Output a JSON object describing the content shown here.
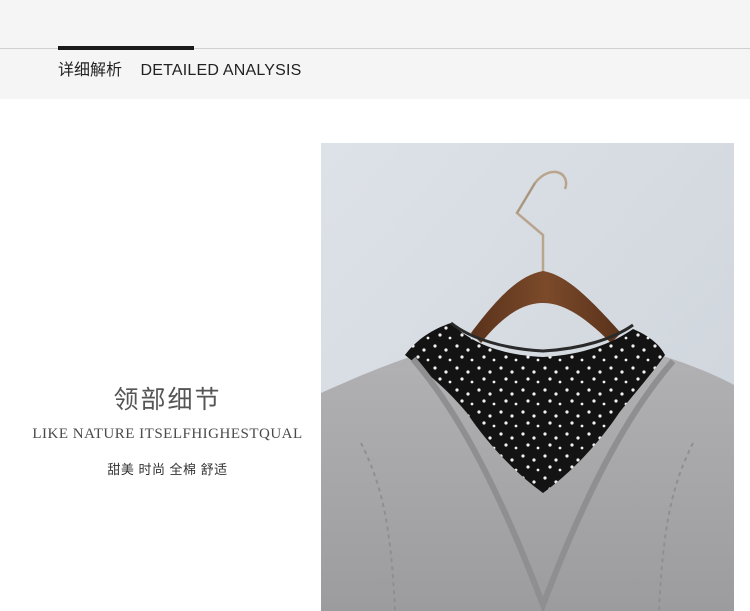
{
  "header": {
    "title_zh": "详细解析",
    "title_en": "DETAILED ANALYSIS"
  },
  "feature": {
    "title_zh": "领部细节",
    "subtitle_en": "LIKE NATURE ITSELFHIGHESTQUAL",
    "tagline": "甜美 时尚 全棉 舒适"
  },
  "colors": {
    "header_bg": "#f5f5f5",
    "accent": "#1a1a1a",
    "sweater": "#a9a9ab",
    "collar": "#141414",
    "hanger_wood": "#6e3f23",
    "wall": "#d6dce3"
  },
  "photo": {
    "icon": "product-photo-collar-detail"
  }
}
